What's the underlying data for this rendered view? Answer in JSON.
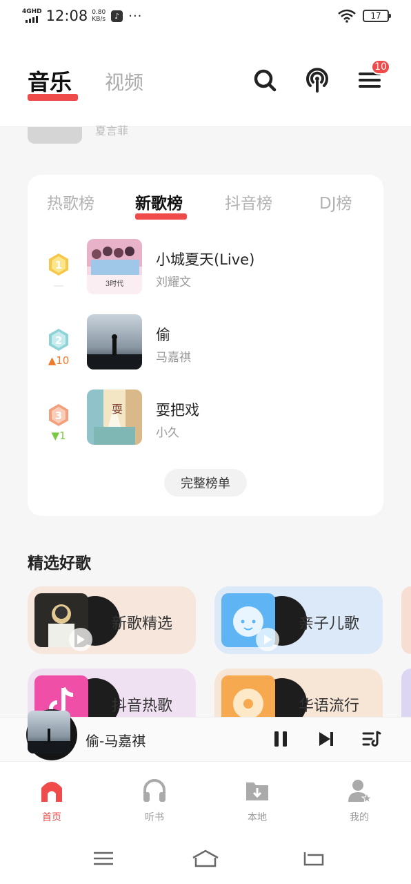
{
  "status_bar": {
    "network": "4GHD",
    "time": "12:08",
    "speed_value": "0.80",
    "speed_unit": "KB/s",
    "dots": "···",
    "battery": "17"
  },
  "header": {
    "tab_music": "音乐",
    "tab_video": "视频",
    "menu_badge": "10"
  },
  "peek": {
    "artist": "夏言菲"
  },
  "chart": {
    "tabs": [
      {
        "label": "热歌榜",
        "active": false
      },
      {
        "label": "新歌榜",
        "active": true
      },
      {
        "label": "抖音榜",
        "active": false
      },
      {
        "label": "DJ榜",
        "active": false
      }
    ],
    "songs": [
      {
        "rank": "1",
        "change": "—",
        "title": "小城夏天(Live)",
        "artist": "刘耀文"
      },
      {
        "rank": "2",
        "change": "▲10",
        "title": "偷",
        "artist": "马嘉祺"
      },
      {
        "rank": "3",
        "change": "▼1",
        "title": "耍把戏",
        "artist": "小久"
      }
    ],
    "full_list_label": "完整榜单"
  },
  "featured": {
    "title": "精选好歌",
    "items": [
      {
        "label": "新歌精选",
        "bg": "#f6e6dc"
      },
      {
        "label": "亲子儿歌",
        "bg": "#dce9f8"
      },
      {
        "label": "抖音热歌",
        "bg": "#efe1f2"
      },
      {
        "label": "华语流行",
        "bg": "#f7e6d6"
      }
    ]
  },
  "mini_player": {
    "title": "偷-马嘉祺"
  },
  "bottom_nav": [
    {
      "label": "首页",
      "icon": "home-icon",
      "active": true
    },
    {
      "label": "听书",
      "icon": "headphones-icon",
      "active": false
    },
    {
      "label": "本地",
      "icon": "download-folder-icon",
      "active": false
    },
    {
      "label": "我的",
      "icon": "user-icon",
      "active": false
    }
  ],
  "colors": {
    "accent": "#ef4b4b",
    "gold": "#f5c84a",
    "silver": "#8fd3d6",
    "bronze": "#f2a07d",
    "up": "#f07a2b",
    "down": "#7ac943"
  }
}
